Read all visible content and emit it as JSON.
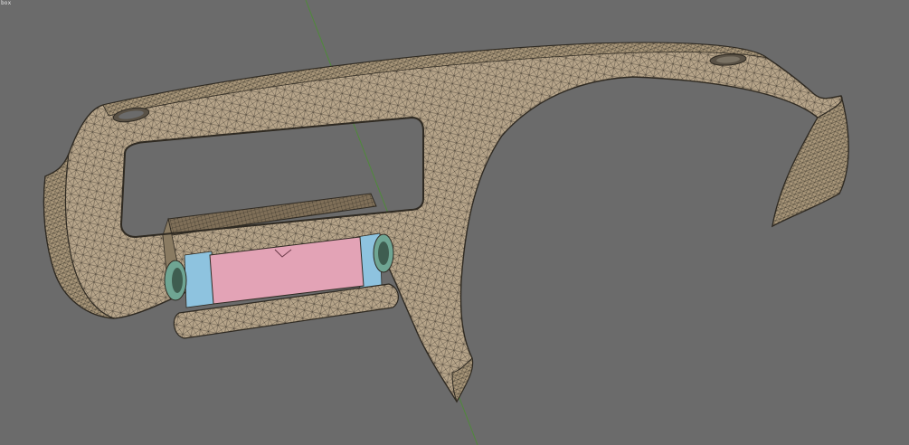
{
  "viewport": {
    "corner_label": "box",
    "background_color": "#6b6b6b",
    "axis_color": "#4f8a3a",
    "mesh_fill_color": "#b7a58a",
    "mesh_line_color": "#2f2a22",
    "glovebox_panel_color": "#e3a3b6",
    "bracket_color": "#8ec3df",
    "vent_color": "#6fa593"
  }
}
